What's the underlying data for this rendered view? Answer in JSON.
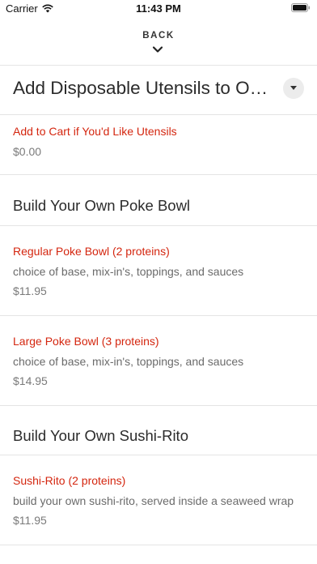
{
  "status_bar": {
    "carrier": "Carrier",
    "time": "11:43 PM"
  },
  "nav": {
    "back_label": "BACK"
  },
  "category": {
    "title": "Add Disposable Utensils to Order"
  },
  "utensils_item": {
    "name": "Add to Cart if You'd Like Utensils",
    "price": "$0.00"
  },
  "sections": {
    "poke_bowl": {
      "title": "Build Your Own Poke Bowl",
      "items": [
        {
          "name": "Regular Poke Bowl (2 proteins)",
          "description": "choice of base, mix-in's, toppings, and sauces",
          "price": "$11.95"
        },
        {
          "name": "Large Poke Bowl (3 proteins)",
          "description": "choice of base, mix-in's, toppings, and sauces",
          "price": "$14.95"
        }
      ]
    },
    "sushi_rito": {
      "title": "Build Your Own Sushi-Rito",
      "items": [
        {
          "name": "Sushi-Rito (2 proteins)",
          "description": "build your own sushi-rito, served inside a seaweed wrap",
          "price": "$11.95"
        }
      ]
    }
  },
  "colors": {
    "item_name": "#d4260f",
    "divider": "#e4e4e4",
    "dropdown_bg": "#ececec"
  }
}
